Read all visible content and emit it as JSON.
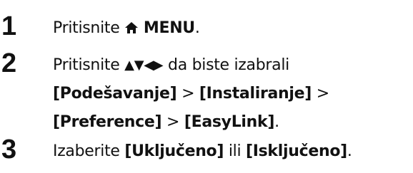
{
  "steps": [
    {
      "number": "1",
      "text_before": "Pritisnite",
      "icon": "home-icon",
      "bold": "MENU",
      "text_after": "."
    },
    {
      "number": "2",
      "text_before": "Pritisnite",
      "arrows": "▲▼◀▶",
      "text_middle": "da biste izabrali",
      "path": {
        "item1": "[Podešavanje]",
        "item2": "[Instaliranje]",
        "item3": "[Preference]",
        "item4": "[EasyLink]",
        "separator": ">",
        "end": "."
      }
    },
    {
      "number": "3",
      "text_before": "Izaberite",
      "option1": "[Uključeno]",
      "connector": "ili",
      "option2": "[Isključeno]",
      "end": "."
    }
  ]
}
